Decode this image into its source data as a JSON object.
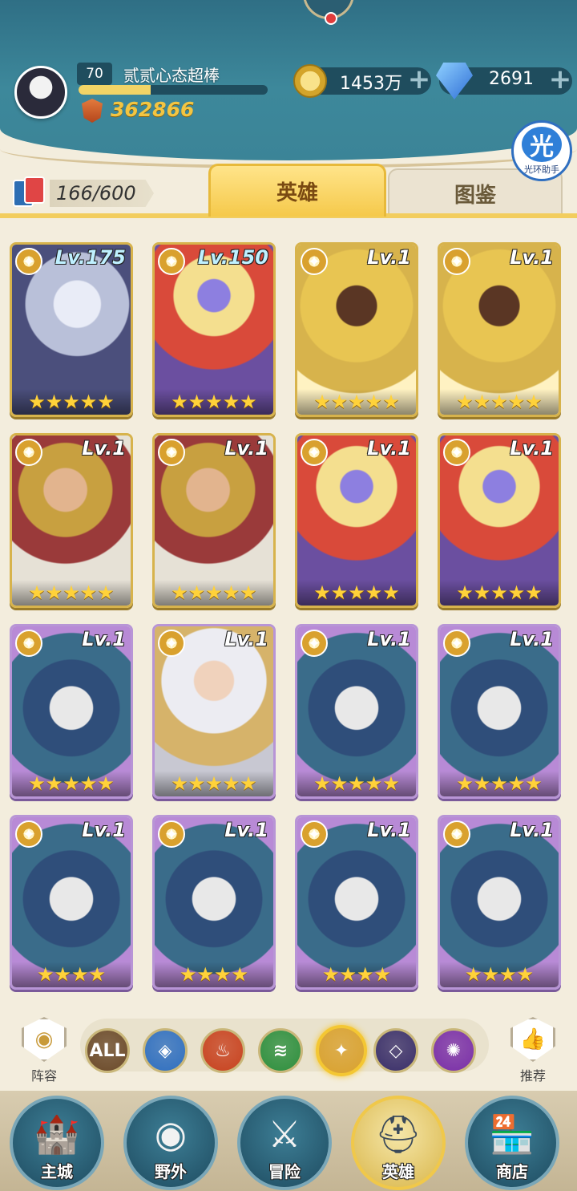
{
  "player": {
    "level": "70",
    "name": "贰贰心态超棒",
    "xp_progress": 0.38,
    "power": "362866"
  },
  "resources": {
    "gold": "1453万",
    "gems": "2691",
    "plus": "+"
  },
  "assistant": {
    "glyph": "光",
    "label": "光环助手"
  },
  "card_count": "166/600",
  "tabs": [
    {
      "label": "英雄",
      "active": true
    },
    {
      "label": "图鉴",
      "active": false
    }
  ],
  "heroes": [
    {
      "level": "Lv.175",
      "stars": "★★★★★",
      "portrait": "silver-haired-elf"
    },
    {
      "level": "Lv.150",
      "stars": "★★★★★",
      "portrait": "red-haired-helmeted-warrior"
    },
    {
      "level": "Lv.1",
      "stars": "★★★★★",
      "portrait": "golden-sun-priestess"
    },
    {
      "level": "Lv.1",
      "stars": "★★★★★",
      "portrait": "golden-sun-priestess"
    },
    {
      "level": "Lv.1",
      "stars": "★★★★★",
      "portrait": "crowned-king"
    },
    {
      "level": "Lv.1",
      "stars": "★★★★★",
      "portrait": "crowned-king"
    },
    {
      "level": "Lv.1",
      "stars": "★★★★★",
      "portrait": "red-haired-helmeted-warrior"
    },
    {
      "level": "Lv.1",
      "stars": "★★★★★",
      "portrait": "red-haired-helmeted-warrior"
    },
    {
      "level": "Lv.1",
      "stars": "★★★★★",
      "portrait": "hooded-sage"
    },
    {
      "level": "Lv.1",
      "stars": "★★★★★",
      "portrait": "white-haired-queen"
    },
    {
      "level": "Lv.1",
      "stars": "★★★★★",
      "portrait": "hooded-sage"
    },
    {
      "level": "Lv.1",
      "stars": "★★★★★",
      "portrait": "hooded-sage"
    },
    {
      "level": "Lv.1",
      "stars": "★★★★",
      "portrait": "hooded-sage"
    },
    {
      "level": "Lv.1",
      "stars": "★★★★",
      "portrait": "hooded-sage"
    },
    {
      "level": "Lv.1",
      "stars": "★★★★",
      "portrait": "hooded-sage"
    },
    {
      "level": "Lv.1",
      "stars": "★★★★",
      "portrait": "hooded-sage"
    }
  ],
  "filters": {
    "lineup_label": "阵容",
    "recommend_label": "推荐",
    "items": [
      {
        "icon": "all-filter-icon",
        "text": "ALL",
        "color": "#6b4a2a"
      },
      {
        "icon": "water-element-icon",
        "text": "",
        "color": "#2f6fc0"
      },
      {
        "icon": "fire-element-icon",
        "text": "",
        "color": "#c8421f"
      },
      {
        "icon": "wind-element-icon",
        "text": "",
        "color": "#2e8f3e"
      },
      {
        "icon": "light-element-icon",
        "text": "",
        "color": "#d9a12e",
        "selected": true
      },
      {
        "icon": "dark-element-icon",
        "text": "",
        "color": "#3a2f6a"
      },
      {
        "icon": "arcane-element-icon",
        "text": "",
        "color": "#7a2fa8"
      }
    ]
  },
  "nav": [
    {
      "label": "主城",
      "icon": "castle-icon"
    },
    {
      "label": "野外",
      "icon": "wilderness-portal-icon"
    },
    {
      "label": "冒险",
      "icon": "sword-icon"
    },
    {
      "label": "英雄",
      "icon": "knight-helmet-icon",
      "active": true
    },
    {
      "label": "商店",
      "icon": "shop-icon"
    }
  ]
}
